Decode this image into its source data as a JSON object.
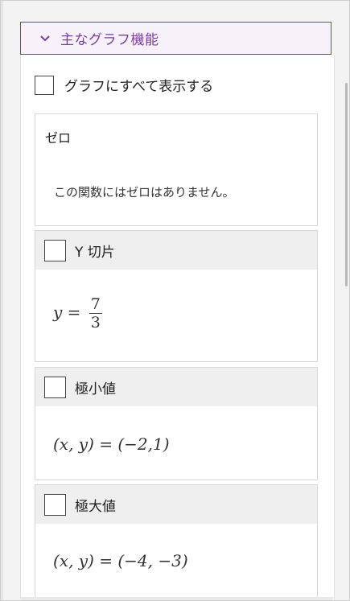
{
  "header": {
    "title": "主なグラフ機能",
    "icon": "chevron-down-icon",
    "accent": "#7b3aa8"
  },
  "show_all": {
    "label": "グラフにすべて表示する",
    "checked": false
  },
  "zero": {
    "title": "ゼロ",
    "text": "この関数にはゼロはありません。"
  },
  "y_intercept": {
    "label": "Y 切片",
    "checked": false,
    "lhs": "y",
    "eq": "=",
    "numerator": "7",
    "denominator": "3"
  },
  "minimum": {
    "label": "極小値",
    "checked": false,
    "value": "(x, y) = (−2,1)"
  },
  "maximum": {
    "label": "極大値",
    "checked": false,
    "value": "(x, y) = (−4, −3)"
  }
}
